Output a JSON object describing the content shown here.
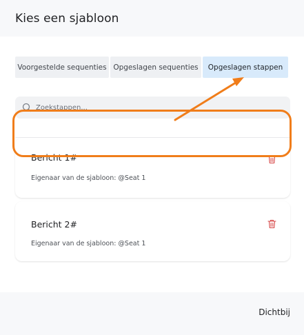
{
  "dialog": {
    "title": "Kies een sjabloon"
  },
  "tabs": [
    {
      "label": "Voorgestelde sequenties",
      "active": false
    },
    {
      "label": "Opgeslagen sequenties",
      "active": false
    },
    {
      "label": "Opgeslagen stappen",
      "active": true
    }
  ],
  "search": {
    "placeholder": "Zoekstappen..."
  },
  "templates": [
    {
      "title": "Bericht 1#",
      "owner": "Eigenaar van de sjabloon: @Seat 1",
      "highlighted": true
    },
    {
      "title": "Bericht 2#",
      "owner": "Eigenaar van de sjabloon: @Seat 1",
      "highlighted": false
    }
  ],
  "footer": {
    "close_label": "Dichtbij"
  },
  "colors": {
    "accent_tab": "#d8eafb",
    "annotation": "#f07d1a",
    "trash": "#d64545"
  },
  "icons": {
    "search": "search-icon",
    "delete": "trash-icon",
    "annotation": "arrow-annotation"
  }
}
